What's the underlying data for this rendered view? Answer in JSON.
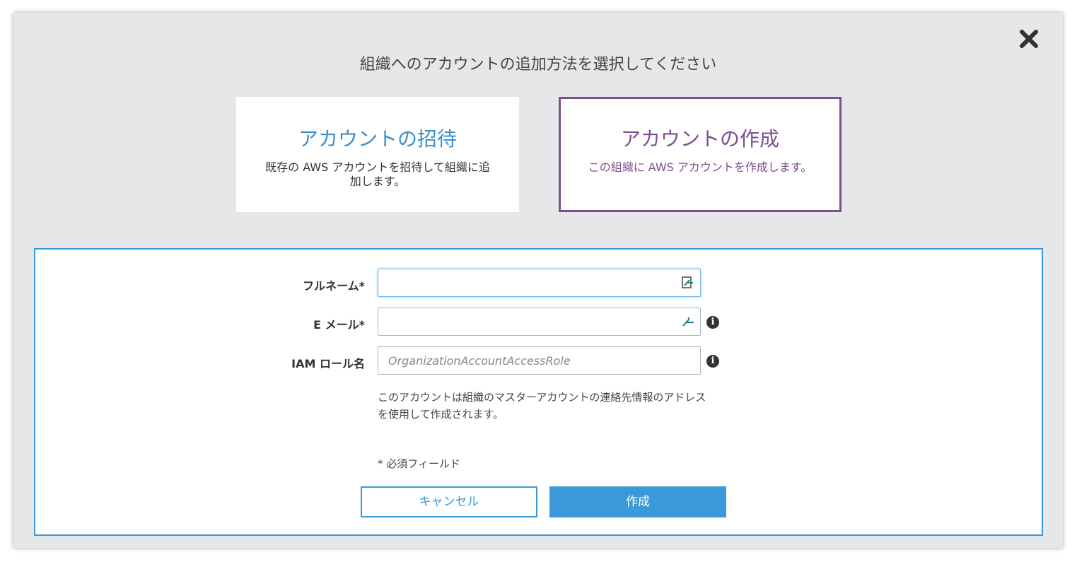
{
  "dialog": {
    "title": "組織へのアカウントの追加方法を選択してください",
    "close_icon": "close-icon"
  },
  "options": [
    {
      "title": "アカウントの招待",
      "description": "既存の AWS アカウントを招待して組織に追加します。",
      "selected": false
    },
    {
      "title": "アカウントの作成",
      "description": "この組織に AWS アカウントを作成します。",
      "selected": true
    }
  ],
  "form": {
    "fullname_label": "フルネーム*",
    "fullname_value": "",
    "email_label": "E メール*",
    "email_value": "",
    "iam_label": "IAM ロール名",
    "iam_placeholder": "OrganizationAccountAccessRole",
    "note": "このアカウントは組織のマスターアカウントの連絡先情報のアドレスを使用して作成されます。",
    "required_note": "* 必須フィールド",
    "info_icon": "i"
  },
  "buttons": {
    "cancel": "キャンセル",
    "create": "作成"
  },
  "colors": {
    "accent_blue": "#3a9ad9",
    "selected_purple": "#7c4f92",
    "modal_bg": "#e6e7e8"
  }
}
